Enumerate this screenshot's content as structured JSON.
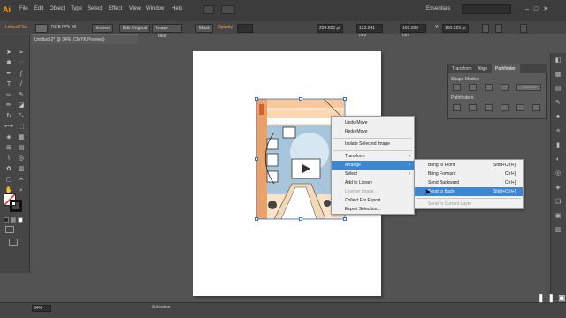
{
  "app": {
    "logo": "Ai"
  },
  "menu": [
    "File",
    "Edit",
    "Object",
    "Type",
    "Select",
    "Effect",
    "View",
    "Window",
    "Help"
  ],
  "workspace": "Essentials",
  "control_bar": {
    "selection_label": "Linked File",
    "color_mode": "RGB",
    "ppi": "PPI: 96",
    "embed_label": "Embed",
    "edit_original_label": "Edit Original",
    "image_trace_label": "Image Trace",
    "mask_label": "Mask",
    "opacity_label": "Opacity:",
    "x_value": "224.623 pt",
    "w_value": "123.041 mm",
    "h_value": "169.560 mm",
    "y_label": "Y:",
    "y_value": "160.229 pt"
  },
  "document_tab": "Untitled-2* @ 34% (CMYK/Preview)",
  "context_menu": {
    "items": [
      {
        "label": "Undo Move",
        "disabled": false
      },
      {
        "label": "Redo Move",
        "disabled": false
      },
      {
        "label": "Isolate Selected Image",
        "disabled": false
      },
      {
        "label": "Transform",
        "disabled": false,
        "submenu": true
      },
      {
        "label": "Arrange",
        "disabled": false,
        "submenu": true,
        "active": true
      },
      {
        "label": "Select",
        "disabled": false,
        "submenu": true
      },
      {
        "label": "Add to Library",
        "disabled": false
      },
      {
        "label": "License Image...",
        "disabled": true
      },
      {
        "label": "Collect For Export",
        "disabled": false
      },
      {
        "label": "Export Selection...",
        "disabled": false
      }
    ]
  },
  "arrange_menu": {
    "items": [
      {
        "label": "Bring to Front",
        "shortcut": "Shift+Ctrl+]"
      },
      {
        "label": "Bring Forward",
        "shortcut": "Ctrl+]"
      },
      {
        "label": "Send Backward",
        "shortcut": "Ctrl+["
      },
      {
        "label": "Send to Back",
        "shortcut": "Shift+Ctrl+[",
        "active": true
      },
      {
        "label": "Send to Current Layer",
        "shortcut": "",
        "disabled": true
      }
    ]
  },
  "pathfinder_panel": {
    "tabs": [
      "Transform",
      "Align",
      "Pathfinder"
    ],
    "active_tab": "Pathfinder",
    "shape_modes_label": "Shape Modes:",
    "expand_label": "Expand",
    "pathfinders_label": "Pathfinders:"
  },
  "status_bar": {
    "zoom": "34%",
    "mode": "Selection"
  },
  "colors": {
    "menu_highlight": "#3d86d0",
    "logo": "#ff9a00",
    "panel_bg": "#535353"
  }
}
